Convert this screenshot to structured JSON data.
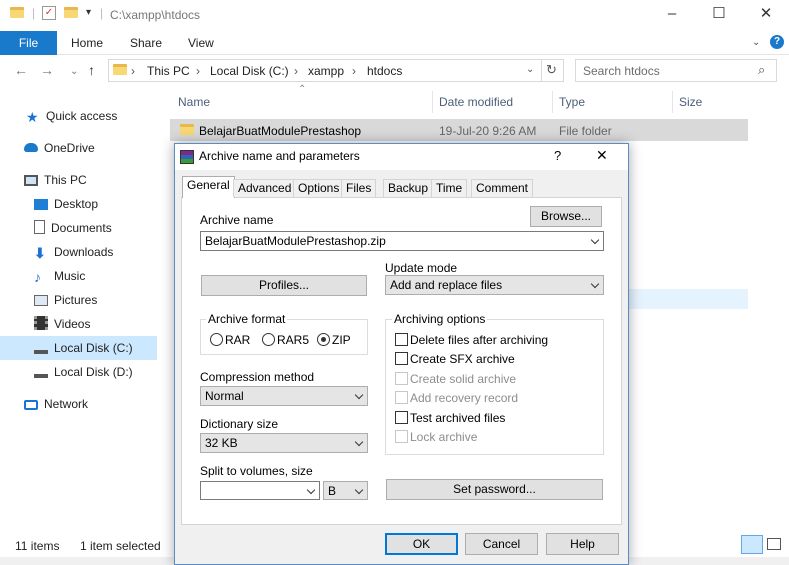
{
  "explorer": {
    "title_path": "C:\\xampp\\htdocs",
    "ribbon_tabs": [
      "File",
      "Home",
      "Share",
      "View"
    ],
    "breadcrumb": [
      "This PC",
      "Local Disk (C:)",
      "xampp",
      "htdocs"
    ],
    "search_placeholder": "Search htdocs",
    "sidebar": [
      {
        "label": "Quick access",
        "icon": "star-icon"
      },
      {
        "label": "OneDrive",
        "icon": "cloud-icon"
      },
      {
        "label": "This PC",
        "icon": "computer-icon"
      },
      {
        "label": "Desktop",
        "icon": "desktop-icon"
      },
      {
        "label": "Documents",
        "icon": "documents-icon"
      },
      {
        "label": "Downloads",
        "icon": "download-icon"
      },
      {
        "label": "Music",
        "icon": "music-icon"
      },
      {
        "label": "Pictures",
        "icon": "pictures-icon"
      },
      {
        "label": "Videos",
        "icon": "videos-icon"
      },
      {
        "label": "Local Disk (C:)",
        "icon": "drive-icon"
      },
      {
        "label": "Local Disk (D:)",
        "icon": "drive-icon"
      },
      {
        "label": "Network",
        "icon": "network-icon"
      }
    ],
    "columns": [
      "Name",
      "Date modified",
      "Type",
      "Size"
    ],
    "files": [
      {
        "name": "BelajarBuatModulePrestashop",
        "date": "19-Jul-20 9:26 AM",
        "type": "File folder"
      }
    ],
    "status": {
      "items": "11 items",
      "selected": "1 item selected"
    }
  },
  "dialog": {
    "title": "Archive name and parameters",
    "help": "?",
    "close": "✕",
    "tabs": [
      "General",
      "Advanced",
      "Options",
      "Files",
      "Backup",
      "Time",
      "Comment"
    ],
    "archive_name_label": "Archive name",
    "archive_name_value": "BelajarBuatModulePrestashop.zip",
    "browse": "Browse...",
    "update_mode_label": "Update mode",
    "update_mode_value": "Add and replace files",
    "profiles": "Profiles...",
    "archive_format_label": "Archive format",
    "formats": [
      "RAR",
      "RAR5",
      "ZIP"
    ],
    "compression_label": "Compression method",
    "compression_value": "Normal",
    "dictionary_label": "Dictionary size",
    "dictionary_value": "32 KB",
    "split_label": "Split to volumes, size",
    "split_unit": "B",
    "archiving_options_label": "Archiving options",
    "options": [
      {
        "label": "Delete files after archiving",
        "enabled": true
      },
      {
        "label": "Create SFX archive",
        "enabled": true
      },
      {
        "label": "Create solid archive",
        "enabled": false
      },
      {
        "label": "Add recovery record",
        "enabled": false
      },
      {
        "label": "Test archived files",
        "enabled": true
      },
      {
        "label": "Lock archive",
        "enabled": false
      }
    ],
    "set_password": "Set password...",
    "ok": "OK",
    "cancel": "Cancel",
    "help_btn": "Help"
  }
}
